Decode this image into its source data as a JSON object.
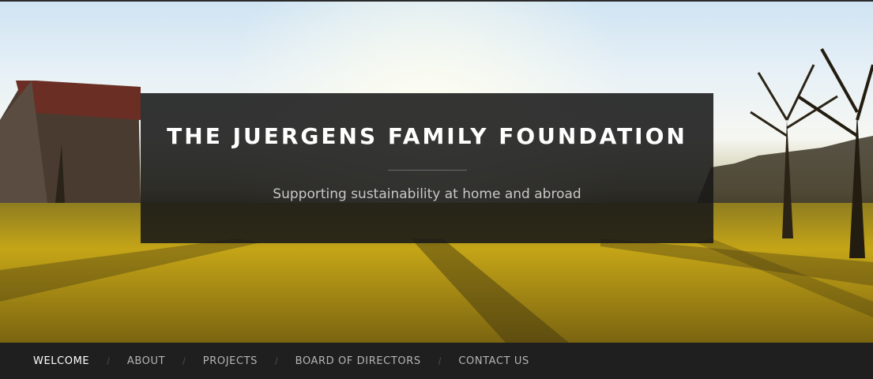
{
  "site": {
    "title": "THE JUERGENS FAMILY FOUNDATION",
    "tagline": "Supporting sustainability at home and abroad"
  },
  "nav": {
    "separator": "/",
    "items": [
      {
        "label": "WELCOME",
        "active": true
      },
      {
        "label": "ABOUT",
        "active": false
      },
      {
        "label": "PROJECTS",
        "active": false
      },
      {
        "label": "BOARD OF DIRECTORS",
        "active": false
      },
      {
        "label": "CONTACT US",
        "active": false
      }
    ]
  },
  "colors": {
    "overlay": "#181818",
    "nav_background": "#1f1f20",
    "nav_text": "#b5b5b5",
    "nav_active": "#ffffff",
    "grass": "#b69618"
  }
}
